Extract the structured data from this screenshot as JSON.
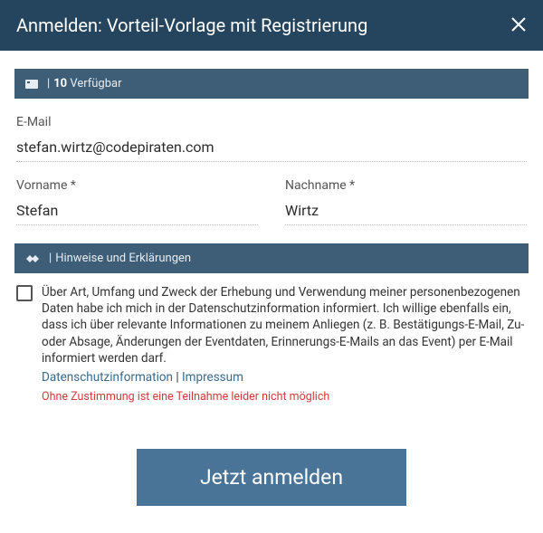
{
  "header": {
    "title": "Anmelden: Vorteil-Vorlage mit Registrierung"
  },
  "availability": {
    "count": "10",
    "label": "Verfügbar"
  },
  "fields": {
    "email": {
      "label": "E-Mail",
      "value": "stefan.wirtz@codepiraten.com"
    },
    "firstname": {
      "label": "Vorname *",
      "value": "Stefan"
    },
    "lastname": {
      "label": "Nachname *",
      "value": "Wirtz"
    }
  },
  "hints": {
    "bar_label": "Hinweise und Erklärungen",
    "consent_text": "Über Art, Umfang und Zweck der Erhebung und Verwendung meiner personenbezogenen Daten habe ich mich in der Datenschutzinformation informiert. Ich willige ebenfalls ein, dass ich über relevante Informationen zu meinem Anliegen (z. B. Bestätigungs-E-Mail, Zu- oder Absage, Änderungen der Eventdaten, Erinnerungs-E-Mails an das Event) per E-Mail informiert werden darf.",
    "privacy_link": "Datenschutzinformation",
    "separator": " | ",
    "imprint_link": "Impressum",
    "warning": "Ohne Zustimmung ist eine Teilnahme leider nicht möglich"
  },
  "submit": {
    "label": "Jetzt anmelden"
  }
}
